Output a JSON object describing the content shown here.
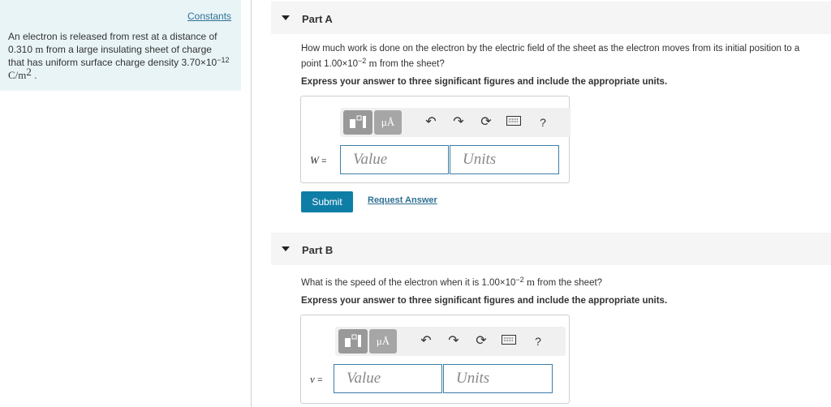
{
  "left": {
    "constants_label": "Constants",
    "text_1": "An electron is released from rest at a distance of",
    "distance": "0.310",
    "unit_m": "m",
    "text_2": "from a large insulating sheet of charge",
    "text_3": "that has uniform surface charge density",
    "density_mantissa": "3.70×10",
    "density_exp": "−12",
    "density_unit": "C/m",
    "density_unit_exp": "2"
  },
  "partA": {
    "title": "Part A",
    "question_1": "How much work is done on the electron by the electric field of the sheet as the electron moves from its initial position to a",
    "question_2a": "point",
    "dist_mantissa": "1.00×10",
    "dist_exp": "−2",
    "dist_unit": "m",
    "question_2b": "from the sheet?",
    "instruction": "Express your answer to three significant figures and include the appropriate units.",
    "variable": "W",
    "equals": "=",
    "value_placeholder": "Value",
    "units_placeholder": "Units",
    "units_button": "μÅ",
    "help": "?",
    "submit": "Submit",
    "request_answer": "Request Answer"
  },
  "partB": {
    "title": "Part B",
    "question_a": "What is the speed of the electron when it is",
    "dist_mantissa": "1.00×10",
    "dist_exp": "−2",
    "dist_unit": "m",
    "question_b": "from the sheet?",
    "instruction": "Express your answer to three significant figures and include the appropriate units.",
    "variable": "v",
    "equals": "=",
    "value_placeholder": "Value",
    "units_placeholder": "Units",
    "units_button": "μÅ",
    "help": "?"
  },
  "icons": [
    "templates-icon",
    "undo-icon",
    "redo-icon",
    "reset-icon",
    "keyboard-icon",
    "help-icon",
    "collapse-caret-icon"
  ],
  "colors": {
    "accent": "#0f7ea6",
    "link": "#2f6f93",
    "panel": "#e9f4f7",
    "header": "#f5f5f5"
  }
}
